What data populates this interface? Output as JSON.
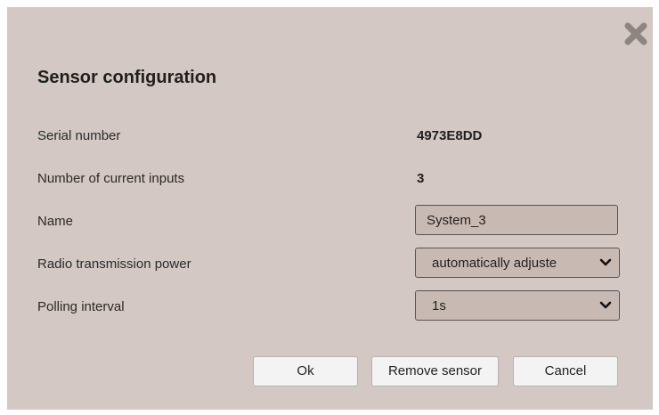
{
  "dialog": {
    "title": "Sensor configuration",
    "close_icon": "close-icon"
  },
  "fields": {
    "serial_number": {
      "label": "Serial number",
      "value": "4973E8DD"
    },
    "current_inputs": {
      "label": "Number of current inputs",
      "value": "3"
    },
    "name": {
      "label": "Name",
      "value": "System_3"
    },
    "radio_power": {
      "label": "Radio transmission power",
      "selected": "automatically adjuste"
    },
    "polling_interval": {
      "label": "Polling interval",
      "selected": "1s"
    }
  },
  "buttons": {
    "ok": "Ok",
    "remove_sensor": "Remove sensor",
    "cancel": "Cancel"
  },
  "colors": {
    "dialog_background": "#d3c8c3",
    "field_background": "#c9b9b3",
    "button_background": "#f3f3f3",
    "close_icon": "#8d8582"
  }
}
